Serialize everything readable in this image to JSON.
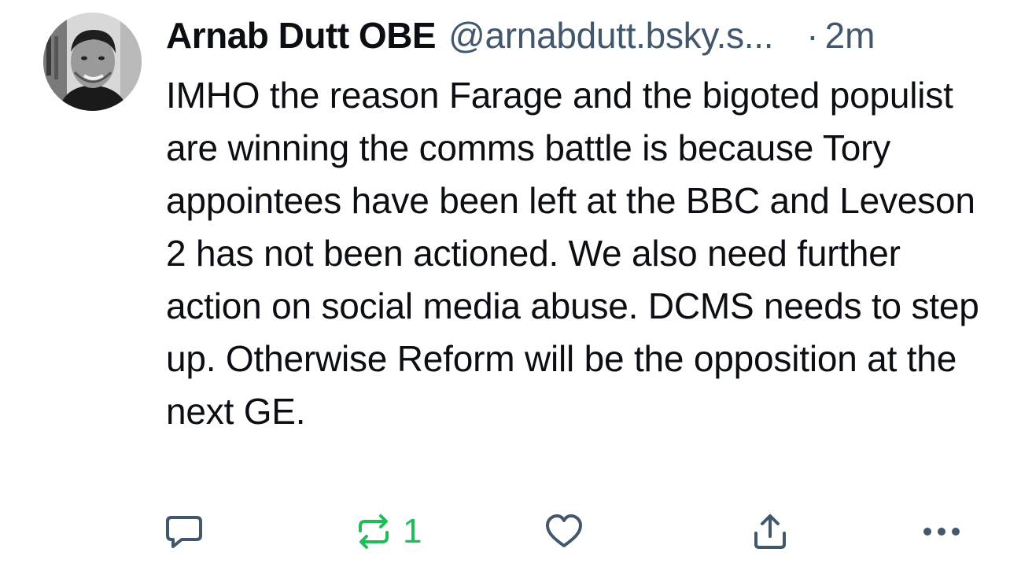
{
  "post": {
    "author_name": "Arnab Dutt OBE",
    "handle": "@arnabdutt.bsky.s...",
    "separator": "·",
    "time": "2m",
    "text": "IMHO the reason Farage and the bigoted populist are winning the comms battle is because Tory appointees have been left at the BBC and Leveson 2 has not been actioned. We also need further action on social media abuse. DCMS needs to step up. Otherwise Reform will be the opposition at the next GE."
  },
  "actions": {
    "reply_icon": "reply-icon",
    "repost_icon": "repost-icon",
    "repost_count": "1",
    "like_icon": "heart-icon",
    "share_icon": "share-icon",
    "more_icon": "more-icon"
  },
  "colors": {
    "text": "#0b0f14",
    "secondary": "#42576c",
    "reposted": "#20bc5a"
  }
}
